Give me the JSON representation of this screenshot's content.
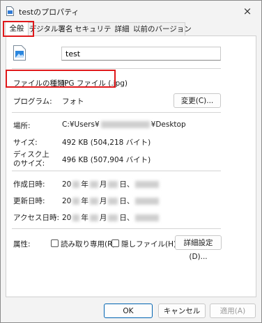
{
  "window": {
    "title": "testのプロパティ",
    "close_icon": "×"
  },
  "tabs": [
    {
      "label": "全般"
    },
    {
      "label": "デジタル署名"
    },
    {
      "label": "セキュリティ"
    },
    {
      "label": "詳細"
    },
    {
      "label": "以前のバージョン"
    }
  ],
  "general": {
    "file_name": "test",
    "file_type_label": "ファイルの種類:",
    "file_type_value": "JPG ファイル (.jpg)",
    "program_label": "プログラム:",
    "program_value": "フォト",
    "change_button": "変更(C)...",
    "location_label": "場所:",
    "location_prefix": "C:¥Users¥",
    "location_suffix": "¥Desktop",
    "size_label": "サイズ:",
    "size_value": "492 KB (504,218 バイト)",
    "disk_size_label1": "ディスク上",
    "disk_size_label2": "のサイズ:",
    "disk_size_value": "496 KB (507,904 バイト)",
    "created_label": "作成日時:",
    "modified_label": "更新日時:",
    "accessed_label": "アクセス日時:",
    "date_prefix": "20",
    "date_year_suffix": "年",
    "date_month_suffix": "月",
    "date_day_suffix": "日、",
    "attributes_label": "属性:",
    "readonly_label": "読み取り専用(R)",
    "hidden_label": "隠しファイル(H)",
    "advanced_button": "詳細設定(D)..."
  },
  "footer": {
    "ok": "OK",
    "cancel": "キャンセル",
    "apply": "適用(A)"
  },
  "colors": {
    "highlight_box": "#e0181a",
    "accent": "#0063b1"
  }
}
